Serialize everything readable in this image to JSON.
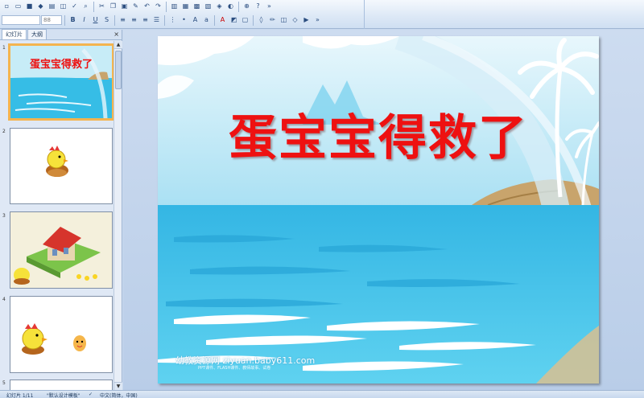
{
  "toolbar": {
    "font_name_value": "",
    "font_size_value": "88"
  },
  "pane": {
    "tabs": [
      {
        "label": "幻灯片"
      },
      {
        "label": "大纲"
      }
    ],
    "close_glyph": "×",
    "slides": [
      {
        "number": "1",
        "title": "蛋宝宝得救了"
      },
      {
        "number": "2"
      },
      {
        "number": "3"
      },
      {
        "number": "4"
      },
      {
        "number": "5"
      }
    ]
  },
  "slide": {
    "title": "蛋宝宝得救了",
    "watermark": "幼教资源网 ziyuan.baby611.com",
    "watermark_sub": "PPT课件、FLASH课件、教师故事、试卷"
  },
  "status": {
    "slide_counter": "幻灯片 1/11",
    "theme": "\"默认设计模板\"",
    "language": "中文(简体，中国)"
  },
  "colors": {
    "title_red": "#ee1111",
    "sea": "#3fc4e8",
    "sky": "#bde6f5",
    "sand": "#c8a46c"
  }
}
